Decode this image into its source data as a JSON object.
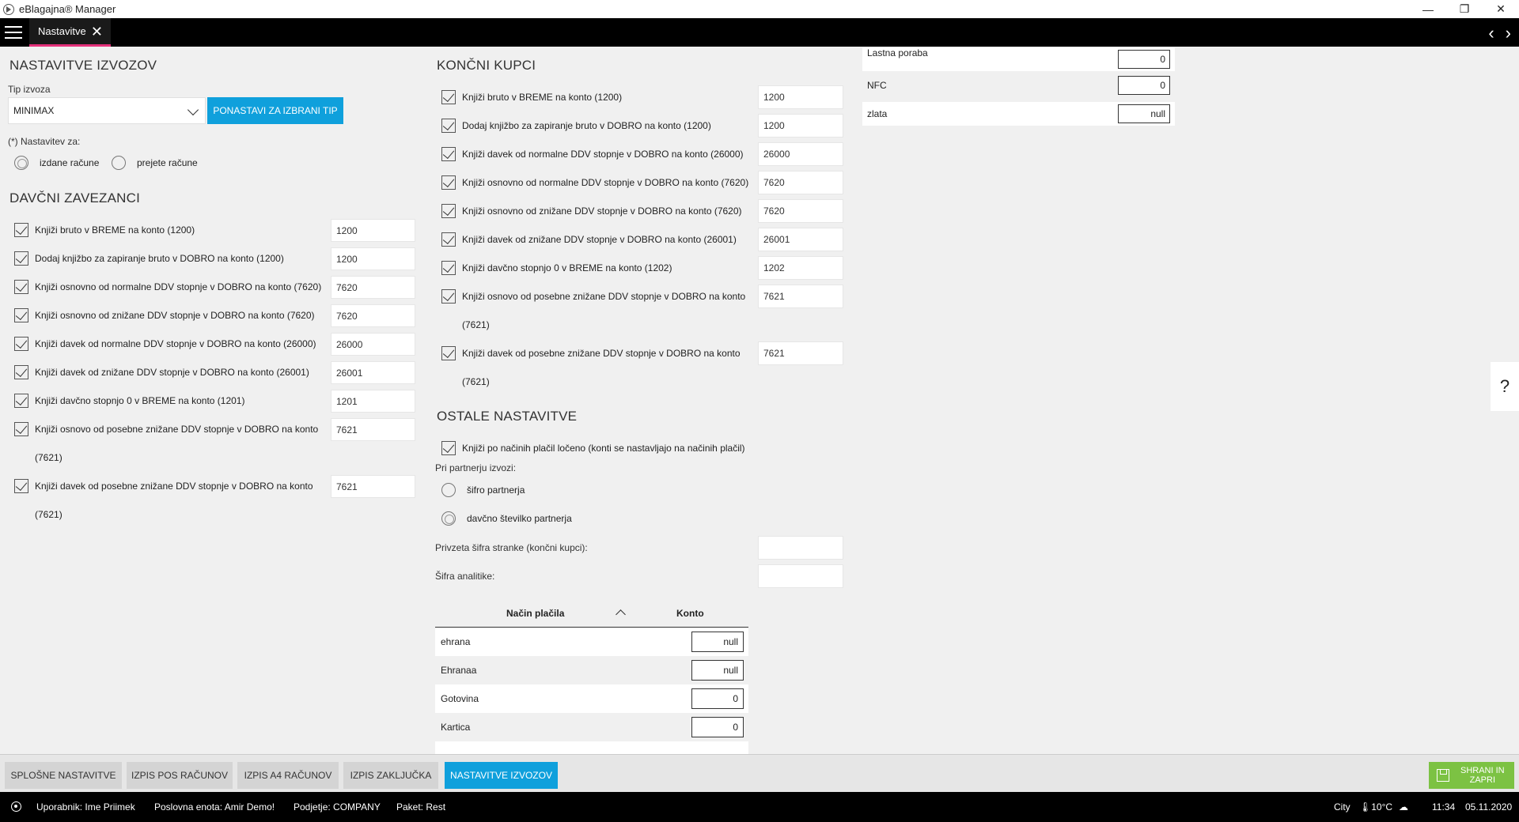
{
  "window": {
    "title": "eBlagajna® Manager",
    "min": "—",
    "max": "❐",
    "close": "✕"
  },
  "tabs": {
    "active_label": "Nastavitve",
    "close": "✕",
    "prev": "‹",
    "next": "›"
  },
  "export": {
    "title": "NASTAVITVE IZVOZOV",
    "type_label": "Tip izvoza",
    "type_value": "MINIMAX",
    "reset_button": "PONASTAVI ZA IZBRANI TIP",
    "settings_for": "(*) Nastavitev za:",
    "radio_issued": "izdane račune",
    "radio_received": "prejete račune"
  },
  "davcni": {
    "title": "DAVČNI ZAVEZANCI",
    "rows": [
      {
        "label": "Knjiži bruto v BREME na konto (1200)",
        "value": "1200"
      },
      {
        "label": "Dodaj knjižbo za zapiranje bruto v DOBRO na konto (1200)",
        "value": "1200"
      },
      {
        "label": "Knjiži osnovno od normalne DDV stopnje v DOBRO na konto (7620)",
        "value": "7620"
      },
      {
        "label": "Knjiži osnovno od znižane DDV stopnje v DOBRO na konto (7620)",
        "value": "7620"
      },
      {
        "label": "Knjiži davek od normalne DDV stopnje v DOBRO na konto (26000)",
        "value": "26000"
      },
      {
        "label": "Knjiži davek od znižane DDV stopnje v DOBRO na konto (26001)",
        "value": "26001"
      },
      {
        "label": "Knjiži davčno stopnjo 0 v BREME na konto (1201)",
        "value": "1201"
      },
      {
        "label": "Knjiži osnovo od posebne znižane DDV stopnje v DOBRO na konto (7621)",
        "value": "7621"
      },
      {
        "label": "Knjiži davek od posebne znižane DDV stopnje v DOBRO na konto (7621)",
        "value": "7621"
      }
    ]
  },
  "koncni": {
    "title": "KONČNI KUPCI",
    "rows": [
      {
        "label": "Knjiži bruto v BREME na konto (1200)",
        "value": "1200"
      },
      {
        "label": "Dodaj knjižbo za zapiranje bruto v DOBRO na konto (1200)",
        "value": "1200"
      },
      {
        "label": "Knjiži davek od normalne DDV stopnje v DOBRO na konto (26000)",
        "value": "26000"
      },
      {
        "label": "Knjiži osnovno od normalne DDV stopnje v DOBRO na konto (7620)",
        "value": "7620"
      },
      {
        "label": "Knjiži osnovno od znižane DDV stopnje v DOBRO na konto (7620)",
        "value": "7620"
      },
      {
        "label": "Knjiži davek od znižane DDV stopnje v DOBRO na konto (26001)",
        "value": "26001"
      },
      {
        "label": "Knjiži davčno stopnjo 0 v BREME na konto (1202)",
        "value": "1202"
      },
      {
        "label": "Knjiži osnovo od posebne znižane DDV stopnje v DOBRO na konto (7621)",
        "value": "7621"
      },
      {
        "label": "Knjiži davek od posebne znižane DDV stopnje v DOBRO na konto (7621)",
        "value": "7621"
      }
    ]
  },
  "ostale": {
    "title": "OSTALE NASTAVITVE",
    "separate_label": "Knjiži po načinih plačil ločeno (konti se nastavljajo na načinih plačil)",
    "partner_label": "Pri partnerju izvozi:",
    "radio_code": "šifro partnerja",
    "radio_tax": "davčno številko partnerja",
    "default_code_label": "Privzeta šifra stranke (končni kupci):",
    "default_code_value": "",
    "analytics_label": "Šifra analitike:",
    "analytics_value": ""
  },
  "payments": {
    "col_method": "Način plačila",
    "col_account": "Konto",
    "rows": [
      {
        "name": "ehrana",
        "value": "null"
      },
      {
        "name": "Ehranaa",
        "value": "null"
      },
      {
        "name": "Gotovina",
        "value": "0"
      },
      {
        "name": "Kartica",
        "value": "0"
      }
    ]
  },
  "right_panel": {
    "rows": [
      {
        "label": "Lastna poraba",
        "value": "0"
      },
      {
        "label": "NFC",
        "value": "0"
      },
      {
        "label": "zlata",
        "value": "null"
      }
    ]
  },
  "help": "?",
  "bottom_tabs": {
    "general": "SPLOŠNE NASTAVITVE",
    "pos": "IZPIS POS RAČUNOV",
    "a4": "IZPIS A4 RAČUNOV",
    "closing": "IZPIS ZAKLJUČKA",
    "exports": "NASTAVITVE IZVOZOV",
    "save_line1": "SHRANI IN",
    "save_line2": "ZAPRI"
  },
  "status": {
    "user": "Uporabnik: Ime Priimek",
    "unit": "Poslovna enota: Amir Demo!",
    "company": "Podjetje: COMPANY",
    "package": "Paket: Rest",
    "city": "City",
    "temp": "🌡10°C",
    "time": "11:34",
    "date": "05.11.2020"
  }
}
